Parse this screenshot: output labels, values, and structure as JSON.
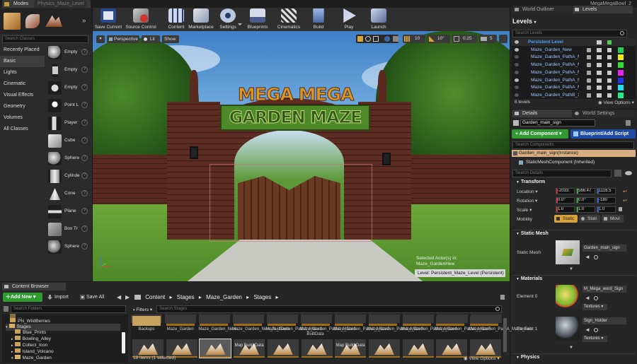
{
  "window": {
    "title": "Physics_Maze_Level",
    "project": "MegaMegaBowl_2"
  },
  "modes": {
    "tab": "Modes",
    "search_placeholder": "Search Classes",
    "categories": [
      "Recently Placed",
      "Basic",
      "Lights",
      "Cinematic",
      "Visual Effects",
      "Geometry",
      "Volumes",
      "All Classes"
    ],
    "selected_category": "Basic",
    "items": [
      "Empty",
      "Empty",
      "Empty",
      "Point L",
      "Player",
      "Cube",
      "Sphere",
      "Cylinde",
      "Cone",
      "Plane",
      "Box Tr",
      "Sphere"
    ]
  },
  "toolbar": {
    "buttons": [
      "Save Current",
      "Source Control",
      "Content",
      "Marketplace",
      "Settings",
      "Blueprints",
      "Cinematics",
      "Build",
      "Play",
      "Launch"
    ]
  },
  "viewport": {
    "perspective": "Perspective",
    "lit": "Lit",
    "show": "Show",
    "grid": "10",
    "angle": "10°",
    "scale": "0.25",
    "camera_speed": "5",
    "selected_actor_line1": "Selected Actor(s) in:",
    "selected_actor_line2": "Maze_GardenHew",
    "level_label": "Level: Persistent_Maze_Level (Persistent)",
    "sign_top": "MEGA MEGA",
    "sign_bottom": "GARDEN MAZE"
  },
  "world_outliner": {
    "tab_outliner": "World Outliner",
    "tab_levels": "Levels"
  },
  "levels": {
    "title": "Levels",
    "search_placeholder": "Search Levels",
    "rows": [
      {
        "name": "Persistent Level",
        "color": "#2a8a2a"
      },
      {
        "name": "Maze_Garden_New",
        "color": "#22cc55"
      },
      {
        "name": "Maze_Garden_PathA_M",
        "color": "#eeee11"
      },
      {
        "name": "Maze_Garden_PathA_M",
        "color": "#33dd33"
      },
      {
        "name": "Maze_Garden_PathA_M",
        "color": "#ee22ee"
      },
      {
        "name": "Maze_Garden_PathA_M",
        "color": "#2233ee"
      },
      {
        "name": "Maze_Garden_PathA_M",
        "color": "#22ddee"
      },
      {
        "name": "Maze_Garden_PathB_1",
        "color": "#22ee88"
      }
    ],
    "count": "8 levels",
    "view_options": "View Options"
  },
  "details": {
    "tab_details": "Details",
    "tab_world": "World Settings",
    "actor_name": "Garden_main_sign",
    "add_component": "+ Add Component",
    "blueprint": "Blueprint/Add Script",
    "search_components": "Search Components",
    "instance": "Garden_main_sign(Instance)",
    "component": "StaticMeshComponent (Inherited)",
    "search_details": "Search Details",
    "transform": "Transform",
    "location_label": "Location",
    "location": [
      "-2033.",
      "566.47",
      "1116.5"
    ],
    "rotation_label": "Rotation",
    "rotation": [
      "0.0°",
      "0.0°",
      "-180"
    ],
    "scale_label": "Scale",
    "scale": [
      "1.0",
      "1.0",
      "1.0"
    ],
    "mobility_label": "Mobility",
    "mobility": [
      "Static",
      "Stati",
      "Movi"
    ],
    "static_mesh_section": "Static Mesh",
    "static_mesh_label": "Static Mesh",
    "static_mesh_value": "Garden_main_sign",
    "materials_section": "Materials",
    "element0_label": "Element 0",
    "element0_value": "M_Mega_word_Sign",
    "element1_label": "Element 1",
    "element1_value": "Sign_Holder",
    "textures": "Textures",
    "physics": "Physics"
  },
  "content_browser": {
    "tab": "Content Browser",
    "add_new": "Add New",
    "import": "Import",
    "save_all": "Save All",
    "path": [
      "Content",
      "Stages",
      "Maze_Garden",
      "Stages"
    ],
    "search_folders": "Search Folders",
    "filters": "Filters",
    "search_assets": "Search Stages",
    "folders": [
      "PN_WildBerries",
      "Stages",
      "Blue_Prints",
      "Bowling_Alley",
      "Collect_Icon",
      "Island_Volcano",
      "Maze_Garden"
    ],
    "assets_row1": [
      "Backups",
      "Maze_Garden",
      "Maze_Garden_New",
      "Maze_Garden_New_BuiltData",
      "Maze_Garden_PathA_Maze1",
      "Maze_Garden_PathA_Maze1-BuiltData",
      "Maze_Garden_PathA_Maze2",
      "Maze_Garden_PathA_Maze3",
      "Maze_Garden_PathA_Maze4",
      "Maze_Garden_PathA_Maze5",
      "Maze_Garden_PathA_Maze_Exit"
    ],
    "assets_row2": [
      "",
      "",
      "",
      "Map Build Data",
      "",
      "",
      "Map Build Data",
      "",
      "",
      "",
      ""
    ],
    "status": "18 items (1 selected)",
    "view_options": "View Options"
  }
}
